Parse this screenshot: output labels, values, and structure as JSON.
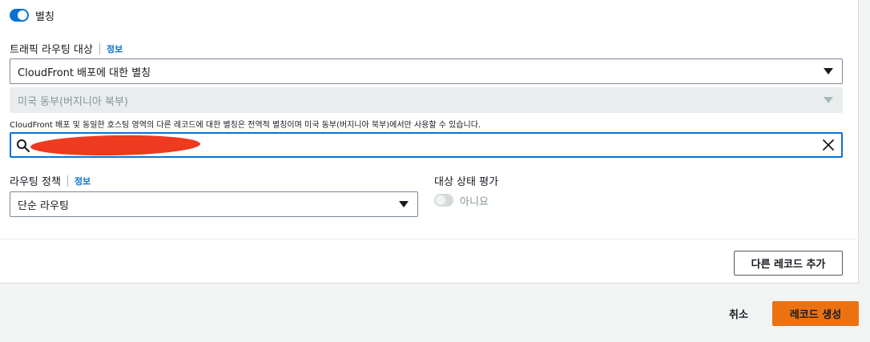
{
  "alias": {
    "label": "별칭",
    "enabled": true
  },
  "routing_target": {
    "label": "트래픽 라우팅 대상",
    "info": "정보",
    "target_type": "CloudFront 배포에 대한 별칭",
    "region": "미국 동부(버지니아 북부)",
    "description": "CloudFront 배포 및 동일한 호스팅 영역의 다른 레코드에 대한 별칭은 전역적 별칭이며 미국 동부(버지니아 북부)에서만 사용할 수 있습니다."
  },
  "routing_policy": {
    "label": "라우팅 정책",
    "info": "정보",
    "value": "단순 라우팅"
  },
  "health_check": {
    "label": "대상 상태 평가",
    "value": "아니요",
    "enabled": false
  },
  "buttons": {
    "add_record": "다른 레코드 추가",
    "cancel": "취소",
    "create": "레코드 생성"
  },
  "colors": {
    "primary": "#ec7211",
    "link": "#0972d3",
    "redaction": "#ee3a1f"
  }
}
